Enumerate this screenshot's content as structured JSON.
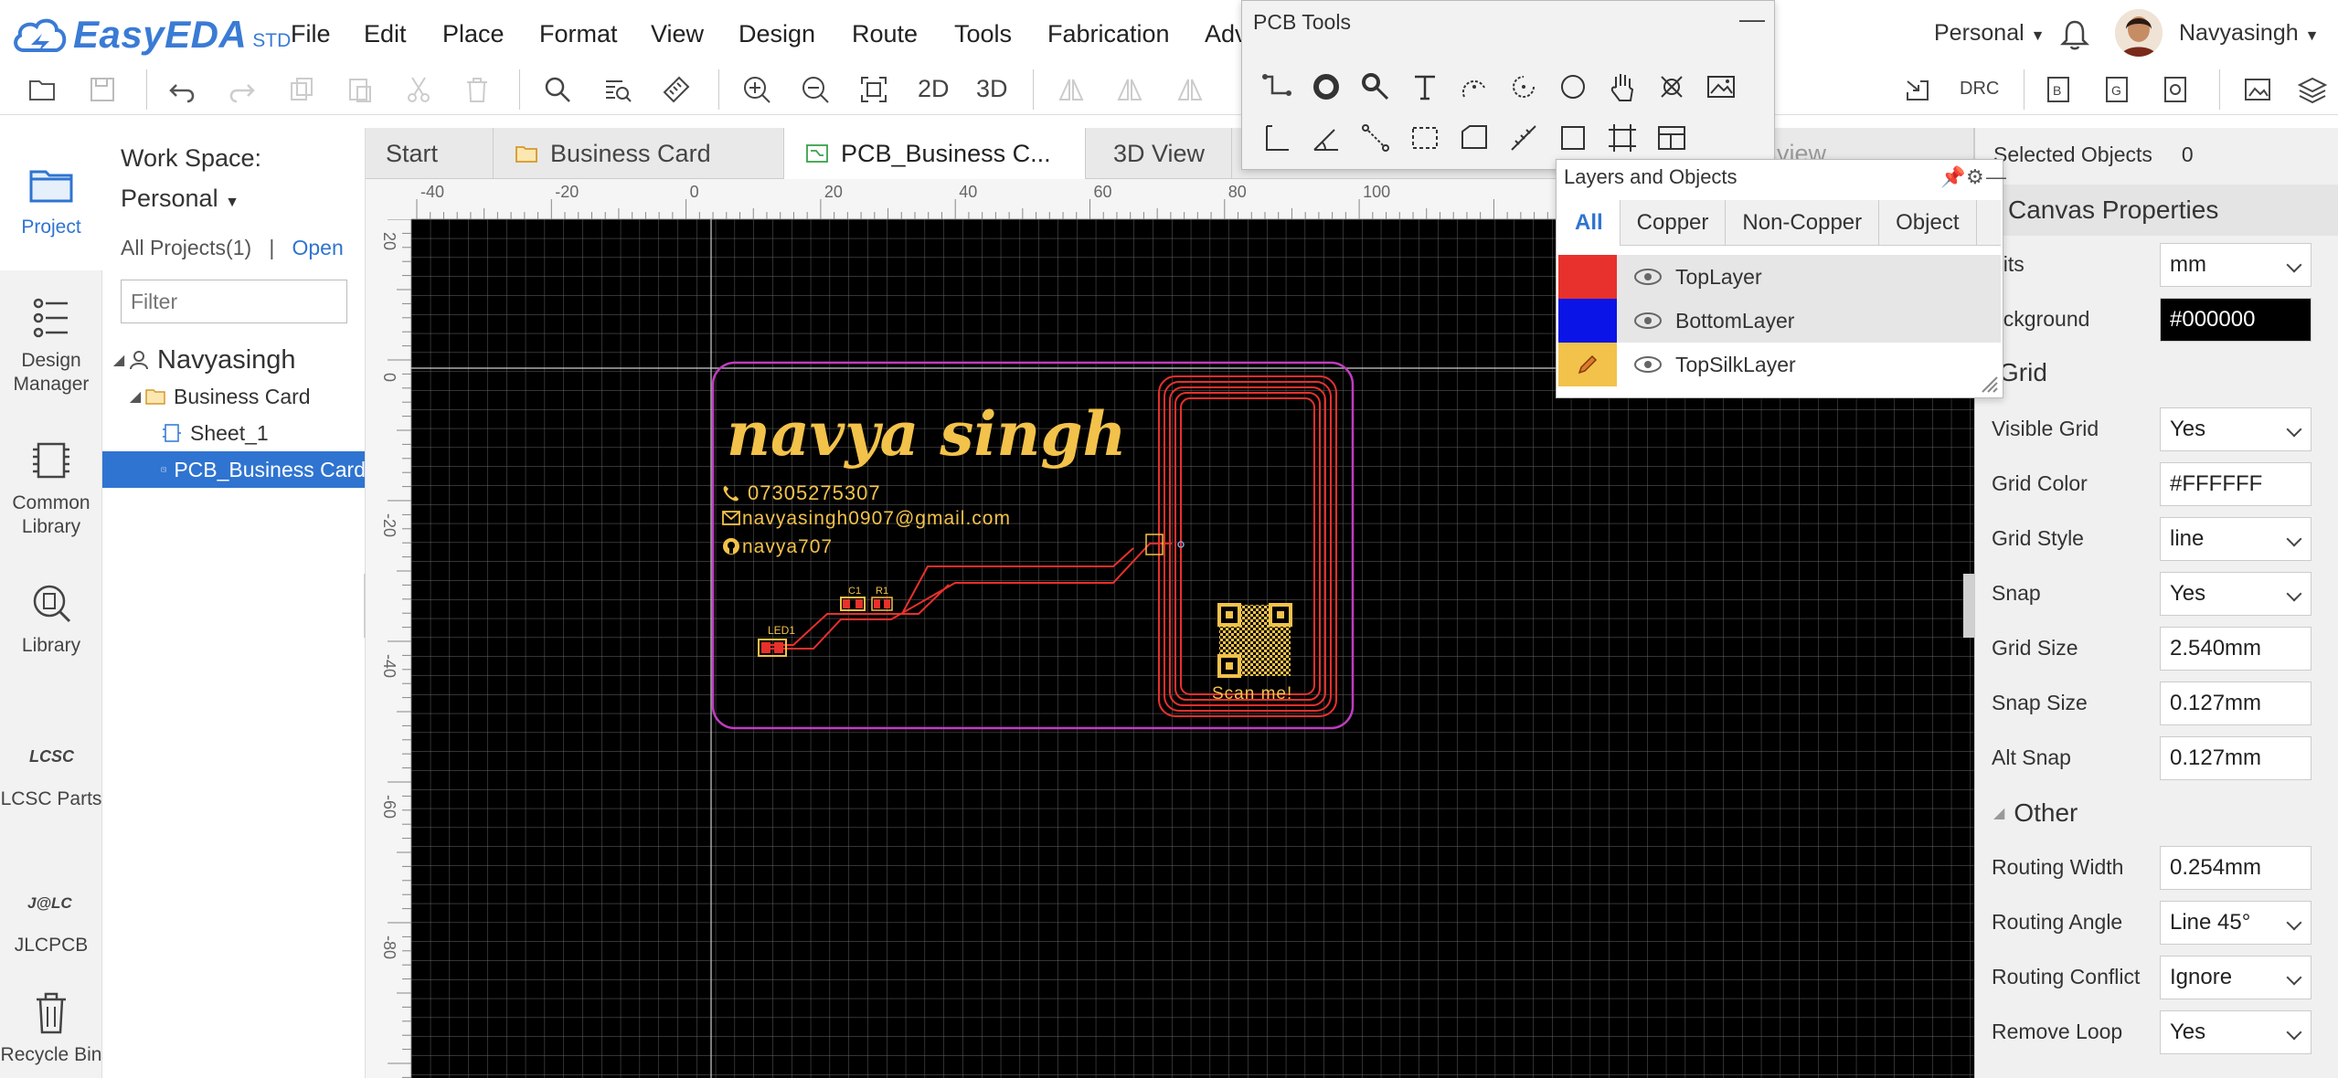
{
  "app": {
    "brand": "EasyEDA",
    "edition": "STD"
  },
  "menu": [
    "File",
    "Edit",
    "Place",
    "Format",
    "View",
    "Design",
    "Route",
    "Tools",
    "Fabrication",
    "Adv"
  ],
  "user": {
    "workspace": "Personal",
    "name": "Navyasingh"
  },
  "toolbar": {
    "btn_2d": "2D",
    "btn_3d": "3D",
    "drc": "DRC"
  },
  "nav": [
    {
      "label": "Project",
      "icon": "folder-icon"
    },
    {
      "label": "Design Manager",
      "icon": "design-manager-icon"
    },
    {
      "label": "Common Library",
      "icon": "chip-icon"
    },
    {
      "label": "Library",
      "icon": "library-icon"
    },
    {
      "label": "LCSC Parts",
      "icon": "lcsc-icon"
    },
    {
      "label": "JLCPCB",
      "icon": "jlcpcb-icon"
    },
    {
      "label": "Recycle Bin",
      "icon": "trash-icon"
    }
  ],
  "project_panel": {
    "workspace_label": "Work Space:",
    "workspace_value": "Personal",
    "all_projects": "All Projects(1)",
    "separator": "|",
    "open_label": "Open",
    "filter_placeholder": "Filter",
    "tree": [
      {
        "label": "Navyasingh",
        "level": 0
      },
      {
        "label": "Business Card",
        "level": 1
      },
      {
        "label": "Sheet_1",
        "level": 2
      },
      {
        "label": "PCB_Business Card",
        "level": 2,
        "selected": true
      }
    ]
  },
  "tabs": [
    {
      "label": "Start"
    },
    {
      "label": "Business Card"
    },
    {
      "label": "PCB_Business C..."
    },
    {
      "label": "3D View"
    },
    {
      "label": "view"
    }
  ],
  "rulers": {
    "top": [
      "-40",
      "-20",
      "0",
      "20",
      "40",
      "60",
      "80",
      "100"
    ],
    "left": [
      "20",
      "0",
      "-20",
      "-40",
      "-60",
      "-80"
    ]
  },
  "pcb": {
    "name": "navya singh",
    "phone": "07305275307",
    "email": "navyasingh0907@gmail.com",
    "github": "navya707",
    "qr_caption": "Scan me!",
    "labels": [
      "LED1",
      "R1",
      "C1"
    ]
  },
  "pcb_tools": {
    "title": "PCB Tools"
  },
  "layers_panel": {
    "title": "Layers and Objects",
    "tabs": [
      "All",
      "Copper",
      "Non-Copper",
      "Object"
    ],
    "layers": [
      {
        "name": "TopLayer",
        "color": "#e8302c"
      },
      {
        "name": "BottomLayer",
        "color": "#0a14e6"
      },
      {
        "name": "TopSilkLayer",
        "color": "#f2c24a"
      }
    ]
  },
  "properties": {
    "selected_label": "Selected Objects",
    "selected_count": "0",
    "canvas_section": "Canvas Properties",
    "grid_section": "Grid",
    "other_section": "Other",
    "rows": [
      {
        "label": "nits",
        "value": "mm"
      },
      {
        "label": "ackground",
        "value": "#000000"
      },
      {
        "label": "Visible Grid",
        "value": "Yes"
      },
      {
        "label": "Grid Color",
        "value": "#FFFFFF"
      },
      {
        "label": "Grid Style",
        "value": "line"
      },
      {
        "label": "Snap",
        "value": "Yes"
      },
      {
        "label": "Grid Size",
        "value": "2.540mm"
      },
      {
        "label": "Snap Size",
        "value": "0.127mm"
      },
      {
        "label": "Alt Snap",
        "value": "0.127mm"
      },
      {
        "label": "Routing Width",
        "value": "0.254mm"
      },
      {
        "label": "Routing Angle",
        "value": "Line 45°"
      },
      {
        "label": "Routing Conflict",
        "value": "Ignore"
      },
      {
        "label": "Remove Loop",
        "value": "Yes"
      }
    ]
  },
  "colors": {
    "accent": "#2f74d0",
    "silk": "#f2c24a",
    "copper": "#e8302c",
    "outline": "#c03cc0"
  }
}
